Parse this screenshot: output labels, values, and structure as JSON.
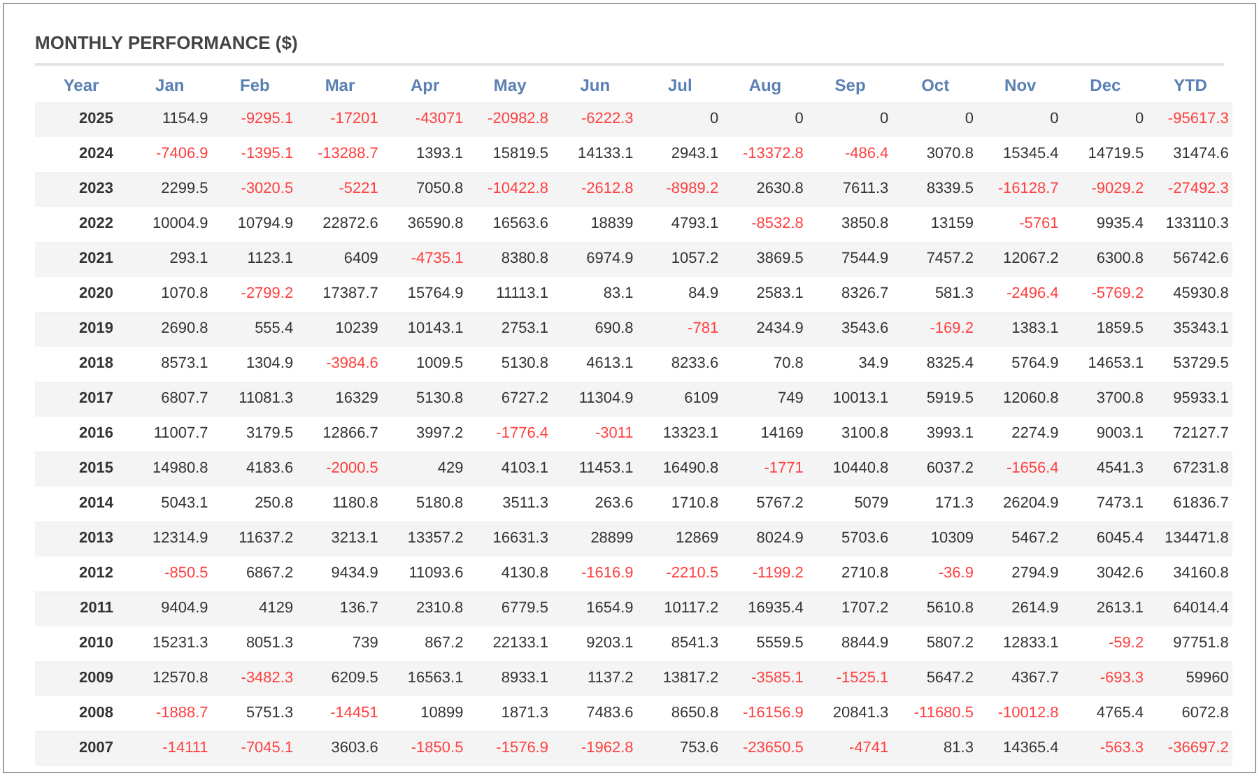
{
  "title": "MONTHLY PERFORMANCE ($)",
  "table": {
    "year_column": "Year",
    "columns": [
      "Jan",
      "Feb",
      "Mar",
      "Apr",
      "May",
      "Jun",
      "Jul",
      "Aug",
      "Sep",
      "Oct",
      "Nov",
      "Dec",
      "YTD"
    ],
    "rows": [
      {
        "year": "2025",
        "cells": [
          {
            "value": "1154.9",
            "negative": false
          },
          {
            "value": "-9295.1",
            "negative": true
          },
          {
            "value": "-17201",
            "negative": true
          },
          {
            "value": "-43071",
            "negative": true
          },
          {
            "value": "-20982.8",
            "negative": true
          },
          {
            "value": "-6222.3",
            "negative": true
          },
          {
            "value": "0",
            "negative": false
          },
          {
            "value": "0",
            "negative": false
          },
          {
            "value": "0",
            "negative": false
          },
          {
            "value": "0",
            "negative": false
          },
          {
            "value": "0",
            "negative": false
          },
          {
            "value": "0",
            "negative": false
          },
          {
            "value": "-95617.3",
            "negative": true
          }
        ]
      },
      {
        "year": "2024",
        "cells": [
          {
            "value": "-7406.9",
            "negative": true
          },
          {
            "value": "-1395.1",
            "negative": true
          },
          {
            "value": "-13288.7",
            "negative": true
          },
          {
            "value": "1393.1",
            "negative": false
          },
          {
            "value": "15819.5",
            "negative": false
          },
          {
            "value": "14133.1",
            "negative": false
          },
          {
            "value": "2943.1",
            "negative": false
          },
          {
            "value": "-13372.8",
            "negative": true
          },
          {
            "value": "-486.4",
            "negative": true
          },
          {
            "value": "3070.8",
            "negative": false
          },
          {
            "value": "15345.4",
            "negative": false
          },
          {
            "value": "14719.5",
            "negative": false
          },
          {
            "value": "31474.6",
            "negative": false
          }
        ]
      },
      {
        "year": "2023",
        "cells": [
          {
            "value": "2299.5",
            "negative": false
          },
          {
            "value": "-3020.5",
            "negative": true
          },
          {
            "value": "-5221",
            "negative": true
          },
          {
            "value": "7050.8",
            "negative": false
          },
          {
            "value": "-10422.8",
            "negative": true
          },
          {
            "value": "-2612.8",
            "negative": true
          },
          {
            "value": "-8989.2",
            "negative": true
          },
          {
            "value": "2630.8",
            "negative": false
          },
          {
            "value": "7611.3",
            "negative": false
          },
          {
            "value": "8339.5",
            "negative": false
          },
          {
            "value": "-16128.7",
            "negative": true
          },
          {
            "value": "-9029.2",
            "negative": true
          },
          {
            "value": "-27492.3",
            "negative": true
          }
        ]
      },
      {
        "year": "2022",
        "cells": [
          {
            "value": "10004.9",
            "negative": false
          },
          {
            "value": "10794.9",
            "negative": false
          },
          {
            "value": "22872.6",
            "negative": false
          },
          {
            "value": "36590.8",
            "negative": false
          },
          {
            "value": "16563.6",
            "negative": false
          },
          {
            "value": "18839",
            "negative": false
          },
          {
            "value": "4793.1",
            "negative": false
          },
          {
            "value": "-8532.8",
            "negative": true
          },
          {
            "value": "3850.8",
            "negative": false
          },
          {
            "value": "13159",
            "negative": false
          },
          {
            "value": "-5761",
            "negative": true
          },
          {
            "value": "9935.4",
            "negative": false
          },
          {
            "value": "133110.3",
            "negative": false
          }
        ]
      },
      {
        "year": "2021",
        "cells": [
          {
            "value": "293.1",
            "negative": false
          },
          {
            "value": "1123.1",
            "negative": false
          },
          {
            "value": "6409",
            "negative": false
          },
          {
            "value": "-4735.1",
            "negative": true
          },
          {
            "value": "8380.8",
            "negative": false
          },
          {
            "value": "6974.9",
            "negative": false
          },
          {
            "value": "1057.2",
            "negative": false
          },
          {
            "value": "3869.5",
            "negative": false
          },
          {
            "value": "7544.9",
            "negative": false
          },
          {
            "value": "7457.2",
            "negative": false
          },
          {
            "value": "12067.2",
            "negative": false
          },
          {
            "value": "6300.8",
            "negative": false
          },
          {
            "value": "56742.6",
            "negative": false
          }
        ]
      },
      {
        "year": "2020",
        "cells": [
          {
            "value": "1070.8",
            "negative": false
          },
          {
            "value": "-2799.2",
            "negative": true
          },
          {
            "value": "17387.7",
            "negative": false
          },
          {
            "value": "15764.9",
            "negative": false
          },
          {
            "value": "11113.1",
            "negative": false
          },
          {
            "value": "83.1",
            "negative": false
          },
          {
            "value": "84.9",
            "negative": false
          },
          {
            "value": "2583.1",
            "negative": false
          },
          {
            "value": "8326.7",
            "negative": false
          },
          {
            "value": "581.3",
            "negative": false
          },
          {
            "value": "-2496.4",
            "negative": true
          },
          {
            "value": "-5769.2",
            "negative": true
          },
          {
            "value": "45930.8",
            "negative": false
          }
        ]
      },
      {
        "year": "2019",
        "cells": [
          {
            "value": "2690.8",
            "negative": false
          },
          {
            "value": "555.4",
            "negative": false
          },
          {
            "value": "10239",
            "negative": false
          },
          {
            "value": "10143.1",
            "negative": false
          },
          {
            "value": "2753.1",
            "negative": false
          },
          {
            "value": "690.8",
            "negative": false
          },
          {
            "value": "-781",
            "negative": true
          },
          {
            "value": "2434.9",
            "negative": false
          },
          {
            "value": "3543.6",
            "negative": false
          },
          {
            "value": "-169.2",
            "negative": true
          },
          {
            "value": "1383.1",
            "negative": false
          },
          {
            "value": "1859.5",
            "negative": false
          },
          {
            "value": "35343.1",
            "negative": false
          }
        ]
      },
      {
        "year": "2018",
        "cells": [
          {
            "value": "8573.1",
            "negative": false
          },
          {
            "value": "1304.9",
            "negative": false
          },
          {
            "value": "-3984.6",
            "negative": true
          },
          {
            "value": "1009.5",
            "negative": false
          },
          {
            "value": "5130.8",
            "negative": false
          },
          {
            "value": "4613.1",
            "negative": false
          },
          {
            "value": "8233.6",
            "negative": false
          },
          {
            "value": "70.8",
            "negative": false
          },
          {
            "value": "34.9",
            "negative": false
          },
          {
            "value": "8325.4",
            "negative": false
          },
          {
            "value": "5764.9",
            "negative": false
          },
          {
            "value": "14653.1",
            "negative": false
          },
          {
            "value": "53729.5",
            "negative": false
          }
        ]
      },
      {
        "year": "2017",
        "cells": [
          {
            "value": "6807.7",
            "negative": false
          },
          {
            "value": "11081.3",
            "negative": false
          },
          {
            "value": "16329",
            "negative": false
          },
          {
            "value": "5130.8",
            "negative": false
          },
          {
            "value": "6727.2",
            "negative": false
          },
          {
            "value": "11304.9",
            "negative": false
          },
          {
            "value": "6109",
            "negative": false
          },
          {
            "value": "749",
            "negative": false
          },
          {
            "value": "10013.1",
            "negative": false
          },
          {
            "value": "5919.5",
            "negative": false
          },
          {
            "value": "12060.8",
            "negative": false
          },
          {
            "value": "3700.8",
            "negative": false
          },
          {
            "value": "95933.1",
            "negative": false
          }
        ]
      },
      {
        "year": "2016",
        "cells": [
          {
            "value": "11007.7",
            "negative": false
          },
          {
            "value": "3179.5",
            "negative": false
          },
          {
            "value": "12866.7",
            "negative": false
          },
          {
            "value": "3997.2",
            "negative": false
          },
          {
            "value": "-1776.4",
            "negative": true
          },
          {
            "value": "-3011",
            "negative": true
          },
          {
            "value": "13323.1",
            "negative": false
          },
          {
            "value": "14169",
            "negative": false
          },
          {
            "value": "3100.8",
            "negative": false
          },
          {
            "value": "3993.1",
            "negative": false
          },
          {
            "value": "2274.9",
            "negative": false
          },
          {
            "value": "9003.1",
            "negative": false
          },
          {
            "value": "72127.7",
            "negative": false
          }
        ]
      },
      {
        "year": "2015",
        "cells": [
          {
            "value": "14980.8",
            "negative": false
          },
          {
            "value": "4183.6",
            "negative": false
          },
          {
            "value": "-2000.5",
            "negative": true
          },
          {
            "value": "429",
            "negative": false
          },
          {
            "value": "4103.1",
            "negative": false
          },
          {
            "value": "11453.1",
            "negative": false
          },
          {
            "value": "16490.8",
            "negative": false
          },
          {
            "value": "-1771",
            "negative": true
          },
          {
            "value": "10440.8",
            "negative": false
          },
          {
            "value": "6037.2",
            "negative": false
          },
          {
            "value": "-1656.4",
            "negative": true
          },
          {
            "value": "4541.3",
            "negative": false
          },
          {
            "value": "67231.8",
            "negative": false
          }
        ]
      },
      {
        "year": "2014",
        "cells": [
          {
            "value": "5043.1",
            "negative": false
          },
          {
            "value": "250.8",
            "negative": false
          },
          {
            "value": "1180.8",
            "negative": false
          },
          {
            "value": "5180.8",
            "negative": false
          },
          {
            "value": "3511.3",
            "negative": false
          },
          {
            "value": "263.6",
            "negative": false
          },
          {
            "value": "1710.8",
            "negative": false
          },
          {
            "value": "5767.2",
            "negative": false
          },
          {
            "value": "5079",
            "negative": false
          },
          {
            "value": "171.3",
            "negative": false
          },
          {
            "value": "26204.9",
            "negative": false
          },
          {
            "value": "7473.1",
            "negative": false
          },
          {
            "value": "61836.7",
            "negative": false
          }
        ]
      },
      {
        "year": "2013",
        "cells": [
          {
            "value": "12314.9",
            "negative": false
          },
          {
            "value": "11637.2",
            "negative": false
          },
          {
            "value": "3213.1",
            "negative": false
          },
          {
            "value": "13357.2",
            "negative": false
          },
          {
            "value": "16631.3",
            "negative": false
          },
          {
            "value": "28899",
            "negative": false
          },
          {
            "value": "12869",
            "negative": false
          },
          {
            "value": "8024.9",
            "negative": false
          },
          {
            "value": "5703.6",
            "negative": false
          },
          {
            "value": "10309",
            "negative": false
          },
          {
            "value": "5467.2",
            "negative": false
          },
          {
            "value": "6045.4",
            "negative": false
          },
          {
            "value": "134471.8",
            "negative": false
          }
        ]
      },
      {
        "year": "2012",
        "cells": [
          {
            "value": "-850.5",
            "negative": true
          },
          {
            "value": "6867.2",
            "negative": false
          },
          {
            "value": "9434.9",
            "negative": false
          },
          {
            "value": "11093.6",
            "negative": false
          },
          {
            "value": "4130.8",
            "negative": false
          },
          {
            "value": "-1616.9",
            "negative": true
          },
          {
            "value": "-2210.5",
            "negative": true
          },
          {
            "value": "-1199.2",
            "negative": true
          },
          {
            "value": "2710.8",
            "negative": false
          },
          {
            "value": "-36.9",
            "negative": true
          },
          {
            "value": "2794.9",
            "negative": false
          },
          {
            "value": "3042.6",
            "negative": false
          },
          {
            "value": "34160.8",
            "negative": false
          }
        ]
      },
      {
        "year": "2011",
        "cells": [
          {
            "value": "9404.9",
            "negative": false
          },
          {
            "value": "4129",
            "negative": false
          },
          {
            "value": "136.7",
            "negative": false
          },
          {
            "value": "2310.8",
            "negative": false
          },
          {
            "value": "6779.5",
            "negative": false
          },
          {
            "value": "1654.9",
            "negative": false
          },
          {
            "value": "10117.2",
            "negative": false
          },
          {
            "value": "16935.4",
            "negative": false
          },
          {
            "value": "1707.2",
            "negative": false
          },
          {
            "value": "5610.8",
            "negative": false
          },
          {
            "value": "2614.9",
            "negative": false
          },
          {
            "value": "2613.1",
            "negative": false
          },
          {
            "value": "64014.4",
            "negative": false
          }
        ]
      },
      {
        "year": "2010",
        "cells": [
          {
            "value": "15231.3",
            "negative": false
          },
          {
            "value": "8051.3",
            "negative": false
          },
          {
            "value": "739",
            "negative": false
          },
          {
            "value": "867.2",
            "negative": false
          },
          {
            "value": "22133.1",
            "negative": false
          },
          {
            "value": "9203.1",
            "negative": false
          },
          {
            "value": "8541.3",
            "negative": false
          },
          {
            "value": "5559.5",
            "negative": false
          },
          {
            "value": "8844.9",
            "negative": false
          },
          {
            "value": "5807.2",
            "negative": false
          },
          {
            "value": "12833.1",
            "negative": false
          },
          {
            "value": "-59.2",
            "negative": true
          },
          {
            "value": "97751.8",
            "negative": false
          }
        ]
      },
      {
        "year": "2009",
        "cells": [
          {
            "value": "12570.8",
            "negative": false
          },
          {
            "value": "-3482.3",
            "negative": true
          },
          {
            "value": "6209.5",
            "negative": false
          },
          {
            "value": "16563.1",
            "negative": false
          },
          {
            "value": "8933.1",
            "negative": false
          },
          {
            "value": "1137.2",
            "negative": false
          },
          {
            "value": "13817.2",
            "negative": false
          },
          {
            "value": "-3585.1",
            "negative": true
          },
          {
            "value": "-1525.1",
            "negative": true
          },
          {
            "value": "5647.2",
            "negative": false
          },
          {
            "value": "4367.7",
            "negative": false
          },
          {
            "value": "-693.3",
            "negative": true
          },
          {
            "value": "59960",
            "negative": false
          }
        ]
      },
      {
        "year": "2008",
        "cells": [
          {
            "value": "-1888.7",
            "negative": true
          },
          {
            "value": "5751.3",
            "negative": false
          },
          {
            "value": "-14451",
            "negative": true
          },
          {
            "value": "10899",
            "negative": false
          },
          {
            "value": "1871.3",
            "negative": false
          },
          {
            "value": "7483.6",
            "negative": false
          },
          {
            "value": "8650.8",
            "negative": false
          },
          {
            "value": "-16156.9",
            "negative": true
          },
          {
            "value": "20841.3",
            "negative": false
          },
          {
            "value": "-11680.5",
            "negative": true
          },
          {
            "value": "-10012.8",
            "negative": true
          },
          {
            "value": "4765.4",
            "negative": false
          },
          {
            "value": "6072.8",
            "negative": false
          }
        ]
      },
      {
        "year": "2007",
        "cells": [
          {
            "value": "-14111",
            "negative": true
          },
          {
            "value": "-7045.1",
            "negative": true
          },
          {
            "value": "3603.6",
            "negative": false
          },
          {
            "value": "-1850.5",
            "negative": true
          },
          {
            "value": "-1576.9",
            "negative": true
          },
          {
            "value": "-1962.8",
            "negative": true
          },
          {
            "value": "753.6",
            "negative": false
          },
          {
            "value": "-23650.5",
            "negative": true
          },
          {
            "value": "-4741",
            "negative": true
          },
          {
            "value": "81.3",
            "negative": false
          },
          {
            "value": "14365.4",
            "negative": false
          },
          {
            "value": "-563.3",
            "negative": true
          },
          {
            "value": "-36697.2",
            "negative": true
          }
        ]
      }
    ]
  }
}
